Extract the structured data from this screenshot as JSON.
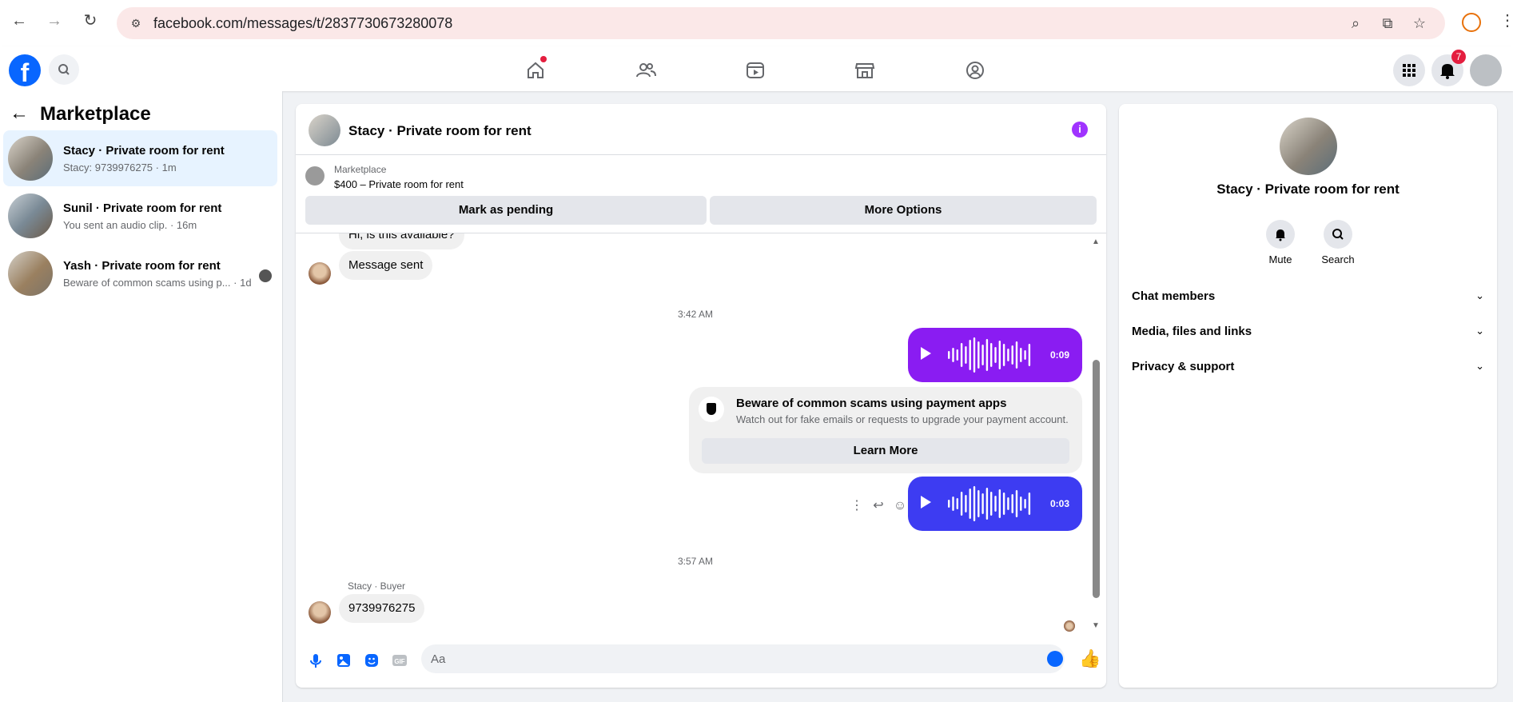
{
  "browser": {
    "url": "facebook.com/messages/t/2837730673280078"
  },
  "header": {
    "logo_letter": "f",
    "notification_count": "7"
  },
  "sidebar": {
    "title": "Marketplace",
    "conversations": [
      {
        "name": "Stacy · Private room for rent",
        "preview": "Stacy: 9739976275 · 1m"
      },
      {
        "name": "Sunil · Private room for rent",
        "preview": "You sent an audio clip. · 16m"
      },
      {
        "name": "Yash · Private room for rent",
        "preview": "Beware of common scams using p...",
        "time": " · 1d"
      }
    ]
  },
  "chat": {
    "title": "Stacy · Private room for rent",
    "listing": {
      "source": "Marketplace",
      "title": "$400 – Private room for rent",
      "buttons": [
        "Mark as pending",
        "More Options"
      ]
    },
    "messages": {
      "partial_text": "Hi, is this available?",
      "sent_text": "Message sent",
      "time1": "3:42 AM",
      "audio1_duration": "0:09",
      "scam_title": "Beware of common scams using payment apps",
      "scam_desc": "Watch out for fake emails or requests to upgrade your payment account.",
      "scam_button": "Learn More",
      "audio2_duration": "0:03",
      "time2": "3:57 AM",
      "sender_label": "Stacy · Buyer",
      "last_text": "9739976275"
    },
    "composer": {
      "placeholder": "Aa"
    },
    "colors": {
      "audio1": "#8a1cf2",
      "audio2": "#3d3cf2"
    }
  },
  "right_panel": {
    "name": "Stacy · Private room for rent",
    "actions": [
      "Mute",
      "Search"
    ],
    "sections": [
      "Chat members",
      "Media, files and links",
      "Privacy & support"
    ]
  }
}
